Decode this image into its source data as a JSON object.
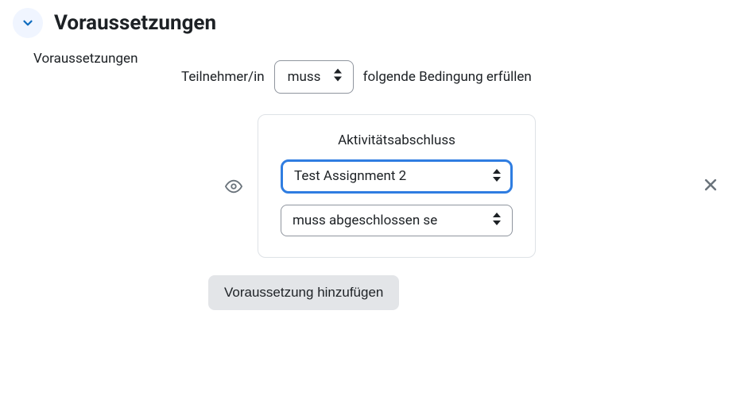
{
  "section": {
    "title": "Voraussetzungen"
  },
  "label": "Voraussetzungen",
  "matchLine": {
    "prefix": "Teilnehmer/in",
    "operator": "muss",
    "suffix": "folgende Bedingung erfüllen"
  },
  "condition": {
    "typeLabel": "Aktivitätsabschluss",
    "activity": "Test Assignment 2",
    "requirement": "muss abgeschlossen se"
  },
  "addButton": "Voraussetzung hinzufügen"
}
